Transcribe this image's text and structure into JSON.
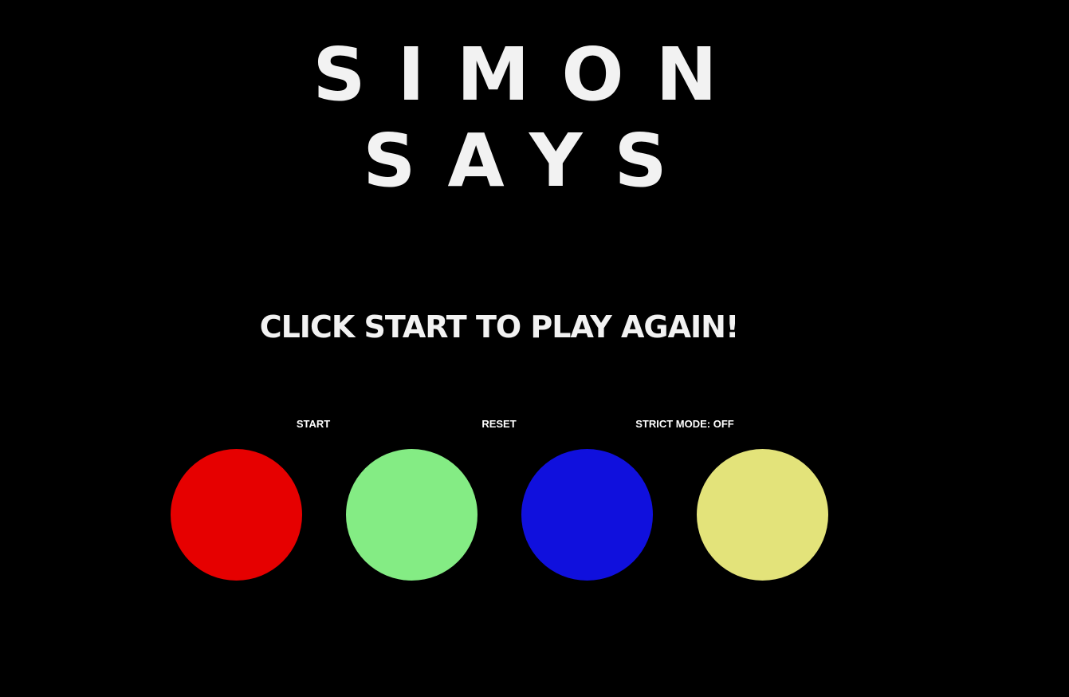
{
  "title": {
    "line1": "SIMON",
    "line2": "SAYS"
  },
  "status_message": "CLICK START TO PLAY AGAIN!",
  "controls": {
    "start_label": "START",
    "reset_label": "RESET",
    "strict_label": "STRICT MODE: OFF"
  },
  "pads": [
    {
      "color": "#e60000"
    },
    {
      "color": "#84ec84"
    },
    {
      "color": "#1010dd"
    },
    {
      "color": "#e3e37a"
    }
  ]
}
